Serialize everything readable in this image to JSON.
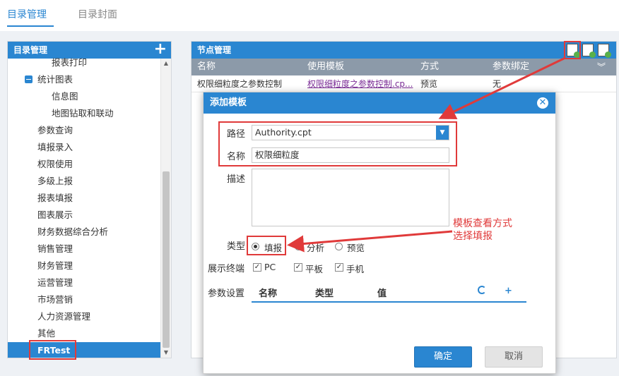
{
  "top_tabs": {
    "directory_management": "目录管理",
    "directory_cover": "目录封面"
  },
  "left_panel": {
    "title": "目录管理",
    "tree": {
      "report_print": "报表打印",
      "stat_charts": "统计图表",
      "info_chart": "信息图",
      "map_drill": "地图钻取和联动",
      "param_query": "参数查询",
      "fill_entry": "填报录入",
      "permission_use": "权限使用",
      "multi_report": "多级上报",
      "report_fill": "报表填报",
      "chart_display": "图表展示",
      "finance_analysis": "财务数据综合分析",
      "sales_mgmt": "销售管理",
      "finance_mgmt": "财务管理",
      "ops_mgmt": "运营管理",
      "marketing": "市场营销",
      "hr_mgmt": "人力资源管理",
      "other": "其他",
      "frtest": "FRTest"
    }
  },
  "right_panel": {
    "title": "节点管理",
    "columns": {
      "name": "名称",
      "template": "使用模板",
      "mode": "方式",
      "param_bind": "参数绑定"
    },
    "row": {
      "name": "权限细粒度之参数控制",
      "template": "权限细粒度之参数控制.cp...",
      "mode": "预览",
      "param_bind": "无"
    }
  },
  "dialog": {
    "title": "添加模板",
    "path_label": "路径",
    "path_value": "Authority.cpt",
    "name_label": "名称",
    "name_value": "权限细粒度",
    "desc_label": "描述",
    "type_label": "类型",
    "type_options": {
      "fill": "填报",
      "analysis": "分析",
      "preview": "预览"
    },
    "terminal_label": "展示终端",
    "terminals": {
      "pc": "PC",
      "tablet": "平板",
      "phone": "手机"
    },
    "param_label": "参数设置",
    "param_columns": {
      "name": "名称",
      "type": "类型",
      "value": "值"
    },
    "ok": "确定",
    "cancel": "取消"
  },
  "annotation": {
    "line1": "模板查看方式",
    "line2": "选择填报"
  },
  "colors": {
    "accent": "#2a86d1",
    "annotation_red": "#e03a3a",
    "header_gray": "#8c9aa9"
  }
}
